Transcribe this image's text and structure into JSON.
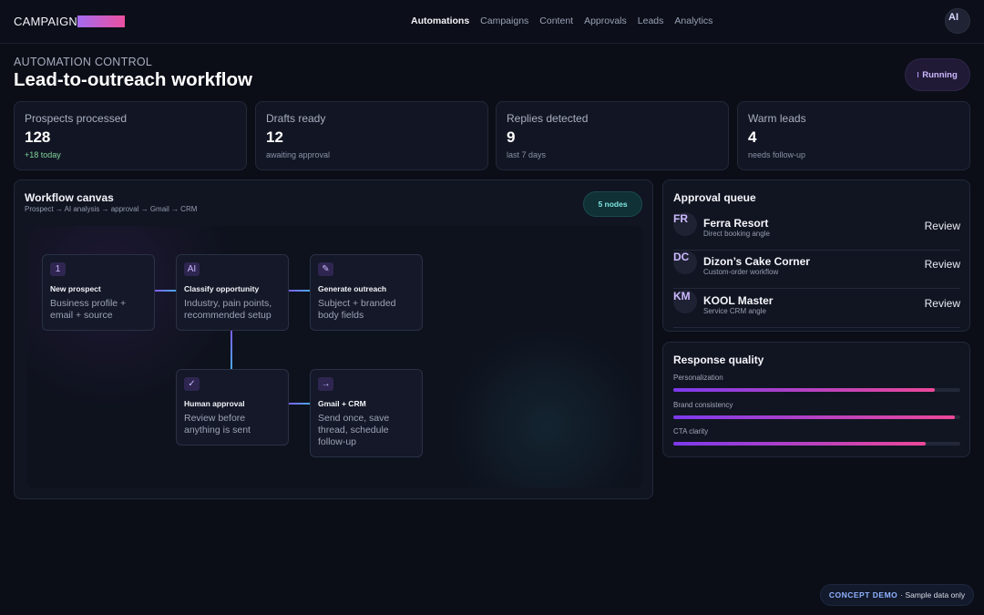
{
  "brand": {
    "name": "CAMPAIGN"
  },
  "nav": {
    "items": [
      {
        "label": "Automations",
        "active": true
      },
      {
        "label": "Campaigns",
        "active": false
      },
      {
        "label": "Content",
        "active": false
      },
      {
        "label": "Approvals",
        "active": false
      },
      {
        "label": "Leads",
        "active": false
      },
      {
        "label": "Analytics",
        "active": false
      }
    ]
  },
  "user": {
    "initials": "AI"
  },
  "header": {
    "eyebrow": "AUTOMATION CONTROL",
    "title": "Lead-to-outreach workflow",
    "status": "Running"
  },
  "stats": [
    {
      "label": "Prospects processed",
      "value": "128",
      "sub": "+18 today"
    },
    {
      "label": "Drafts ready",
      "value": "12",
      "sub": "awaiting approval"
    },
    {
      "label": "Replies detected",
      "value": "9",
      "sub": "last 7 days"
    },
    {
      "label": "Warm leads",
      "value": "4",
      "sub": "needs follow-up"
    }
  ],
  "workflow": {
    "title": "Workflow canvas",
    "subtitle": "Prospect → AI analysis → approval → Gmail → CRM",
    "node_count": "5 nodes",
    "nodes": [
      {
        "badge": "1",
        "title": "New prospect",
        "desc": "Business profile + email + source"
      },
      {
        "badge": "AI",
        "title": "Classify opportunity",
        "desc": "Industry, pain points, recommended setup"
      },
      {
        "badge": "✎",
        "title": "Generate outreach",
        "desc": "Subject + branded body fields"
      },
      {
        "badge": "✓",
        "title": "Human approval",
        "desc": "Review before anything is sent"
      },
      {
        "badge": "→",
        "title": "Gmail + CRM",
        "desc": "Send once, save thread, schedule follow-up"
      }
    ]
  },
  "queue": {
    "title": "Approval queue",
    "items": [
      {
        "initials": "FR",
        "name": "Ferra Resort",
        "sub": "Direct booking angle",
        "action": "Review"
      },
      {
        "initials": "DC",
        "name": "Dizon’s Cake Corner",
        "sub": "Custom-order workflow",
        "action": "Review"
      },
      {
        "initials": "KM",
        "name": "KOOL Master",
        "sub": "Service CRM angle",
        "action": "Review"
      }
    ]
  },
  "quality": {
    "title": "Response quality",
    "metrics": [
      {
        "label": "Personalization",
        "value": 0.91
      },
      {
        "label": "Brand consistency",
        "value": 0.98
      },
      {
        "label": "CTA clarity",
        "value": 0.88
      }
    ]
  },
  "footer": {
    "tag": "CONCEPT DEMO",
    "note": "· Sample data only"
  },
  "colors": {
    "background": "#0b0e17",
    "panel": "#111522",
    "accent_purple": "#7c3aed",
    "accent_pink": "#ec4899",
    "accent_teal": "#7fe5e0",
    "positive": "#7fd49a"
  }
}
